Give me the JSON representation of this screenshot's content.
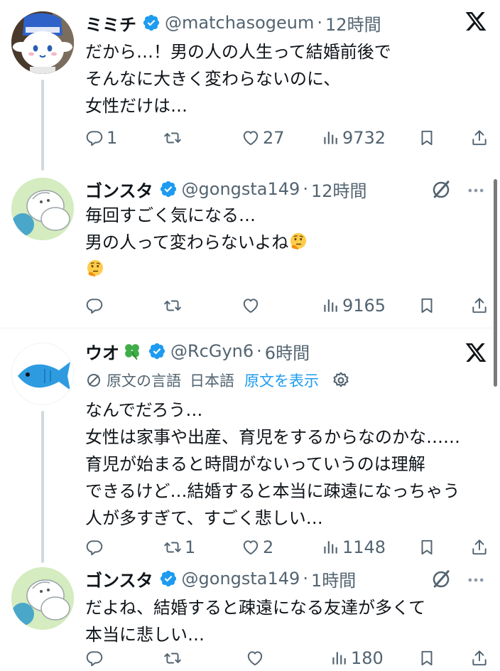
{
  "tweets": [
    {
      "name": "ミミチ",
      "handle": "@matchasogeum",
      "time": "12時間",
      "text": "だから…！男の人の人生って結婚前後で\nそんなに大きく変わらないのに、\n女性だけは…",
      "reply_count": "1",
      "retweet_count": "",
      "like_count": "27",
      "view_count": "9732"
    },
    {
      "name": "ゴンスタ",
      "handle": "@gongsta149",
      "time": "12時間",
      "text_line1": "毎回すごく気になる…",
      "text_line2": "男の人って変わらないよね",
      "reply_count": "",
      "retweet_count": "",
      "like_count": "",
      "view_count": "9165"
    },
    {
      "name": "ウオ",
      "handle": "@RcGyn6",
      "time": "6時間",
      "translate_source": "原文の言語",
      "translate_lang": "日本語",
      "translate_link": "原文を表示",
      "text": "なんでだろう…\n女性は家事や出産、育児をするからなのかな……\n育児が始まると時間がないっていうのは理解\nできるけど…結婚すると本当に疎遠になっちゃう\n人が多すぎて、すごく悲しい…",
      "reply_count": "",
      "retweet_count": "1",
      "like_count": "2",
      "view_count": "1148"
    },
    {
      "name": "ゴンスタ",
      "handle": "@gongsta149",
      "time": "1時間",
      "text": "だよね、結婚すると疎遠になる友達が多くて\n本当に悲しい…",
      "reply_count": "",
      "retweet_count": "",
      "like_count": "",
      "view_count": "180"
    }
  ],
  "icons": {
    "verified": "verified-badge-icon",
    "x_logo": "x-logo-icon",
    "reply": "reply-icon",
    "retweet": "retweet-icon",
    "like": "like-icon",
    "views": "views-icon",
    "bookmark": "bookmark-icon",
    "share": "share-icon",
    "grok": "grok-icon",
    "more": "more-icon",
    "clover": "four-leaf-clover-icon",
    "thinking": "thinking-face-emoji",
    "settings": "gear-icon",
    "translate": "translate-icon"
  },
  "colors": {
    "accent": "#1d9bf0",
    "text": "#0f1419",
    "muted": "#536471",
    "verified": "#1d9bf0"
  }
}
